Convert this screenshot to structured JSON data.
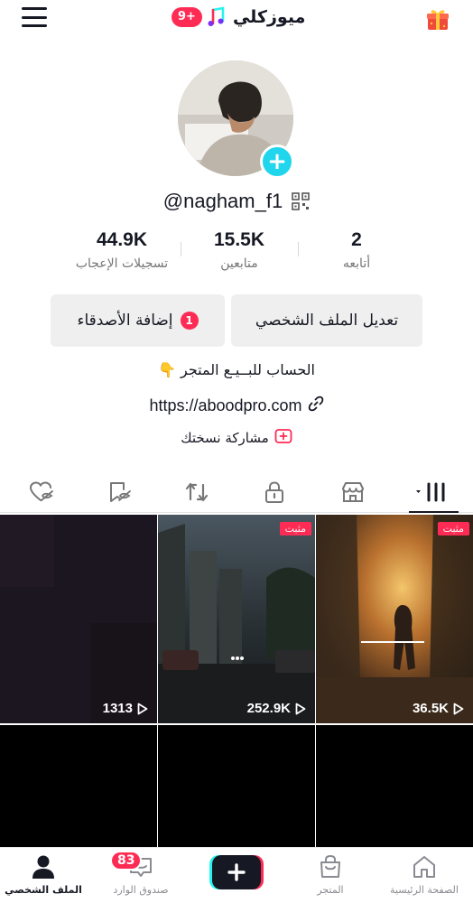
{
  "header": {
    "title": "ميوزكلي",
    "notification_count": "9+",
    "menu_icon": "menu-icon",
    "gift_icon": "gift-icon"
  },
  "profile": {
    "username": "@nagham_f1",
    "stats": [
      {
        "value": "44.9K",
        "label": "تسجيلات الإعجاب"
      },
      {
        "value": "15.5K",
        "label": "متابعين"
      },
      {
        "value": "2",
        "label": "أتابعه"
      }
    ],
    "edit_button": "تعديل الملف الشخصي",
    "add_friends_button": "إضافة الأصدقاء",
    "add_friends_count": "1",
    "bio": "الحساب للبــيـع المتجر 👇",
    "link": "https://aboodpro.com",
    "share_label": "مشاركة نسختك"
  },
  "videos": [
    {
      "views": "1313",
      "pinned": ""
    },
    {
      "views": "252.9K",
      "pinned": "مثبت"
    },
    {
      "views": "36.5K",
      "pinned": "مثبت"
    }
  ],
  "nav": {
    "home": "الصفحة الرئيسية",
    "shop": "المتجر",
    "inbox": "صندوق الوارد",
    "inbox_count": "83",
    "profile": "الملف الشخصي"
  },
  "colors": {
    "accent": "#fe2c55",
    "cyan": "#20d5ec"
  }
}
